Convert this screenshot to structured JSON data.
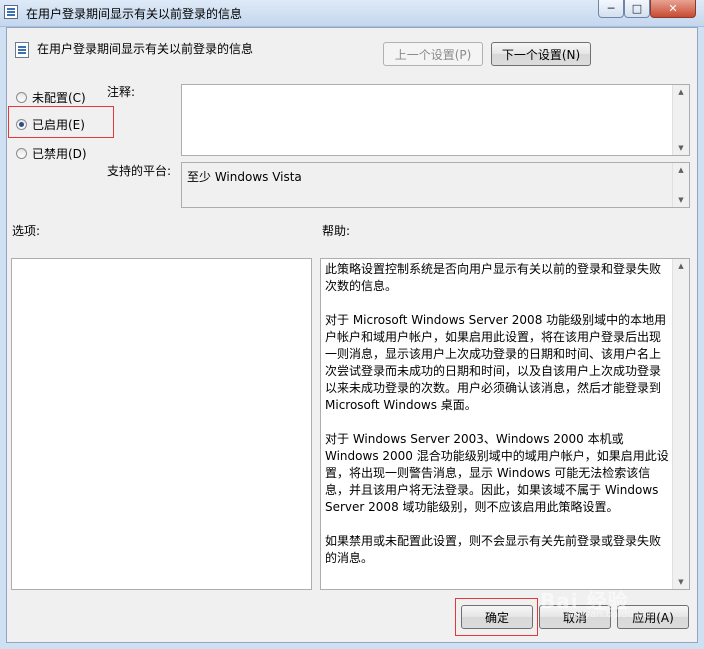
{
  "window": {
    "title": "在用户登录期间显示有关以前登录的信息",
    "controls": {
      "minimize": "─",
      "maximize": "□",
      "close": "✕"
    }
  },
  "header": {
    "setting_title": "在用户登录期间显示有关以前登录的信息",
    "prev_button": "上一个设置(P)",
    "next_button": "下一个设置(N)"
  },
  "state": {
    "options": [
      {
        "label": "未配置(C)",
        "checked": false
      },
      {
        "label": "已启用(E)",
        "checked": true
      },
      {
        "label": "已禁用(D)",
        "checked": false
      }
    ]
  },
  "comment": {
    "label": "注释:",
    "value": ""
  },
  "platform": {
    "label": "支持的平台:",
    "value": "至少 Windows Vista"
  },
  "options_section": {
    "label": "选项:"
  },
  "help": {
    "label": "帮助:",
    "paragraphs": [
      "此策略设置控制系统是否向用户显示有关以前的登录和登录失败次数的信息。",
      "对于 Microsoft Windows Server 2008 功能级别域中的本地用户帐户和域用户帐户，如果启用此设置，将在该用户登录后出现一则消息，显示该用户上次成功登录的日期和时间、该用户名上次尝试登录而未成功的日期和时间，以及自该用户上次成功登录以来未成功登录的次数。用户必须确认该消息，然后才能登录到 Microsoft Windows 桌面。",
      "对于 Windows Server 2003、Windows 2000 本机或 Windows 2000 混合功能级别域中的域用户帐户，如果启用此设置，将出现一则警告消息，显示 Windows 可能无法检索该信息，并且该用户将无法登录。因此，如果该域不属于 Windows Server 2008 域功能级别，则不应该启用此策略设置。",
      "如果禁用或未配置此设置，则不会显示有关先前登录或登录失败的消息。"
    ]
  },
  "footer": {
    "ok_button": "确定",
    "cancel_button": "取消",
    "apply_button": "应用(A)"
  },
  "watermark": {
    "text": "Bai 经验",
    "subtext": "jingyan.baidu.com"
  }
}
